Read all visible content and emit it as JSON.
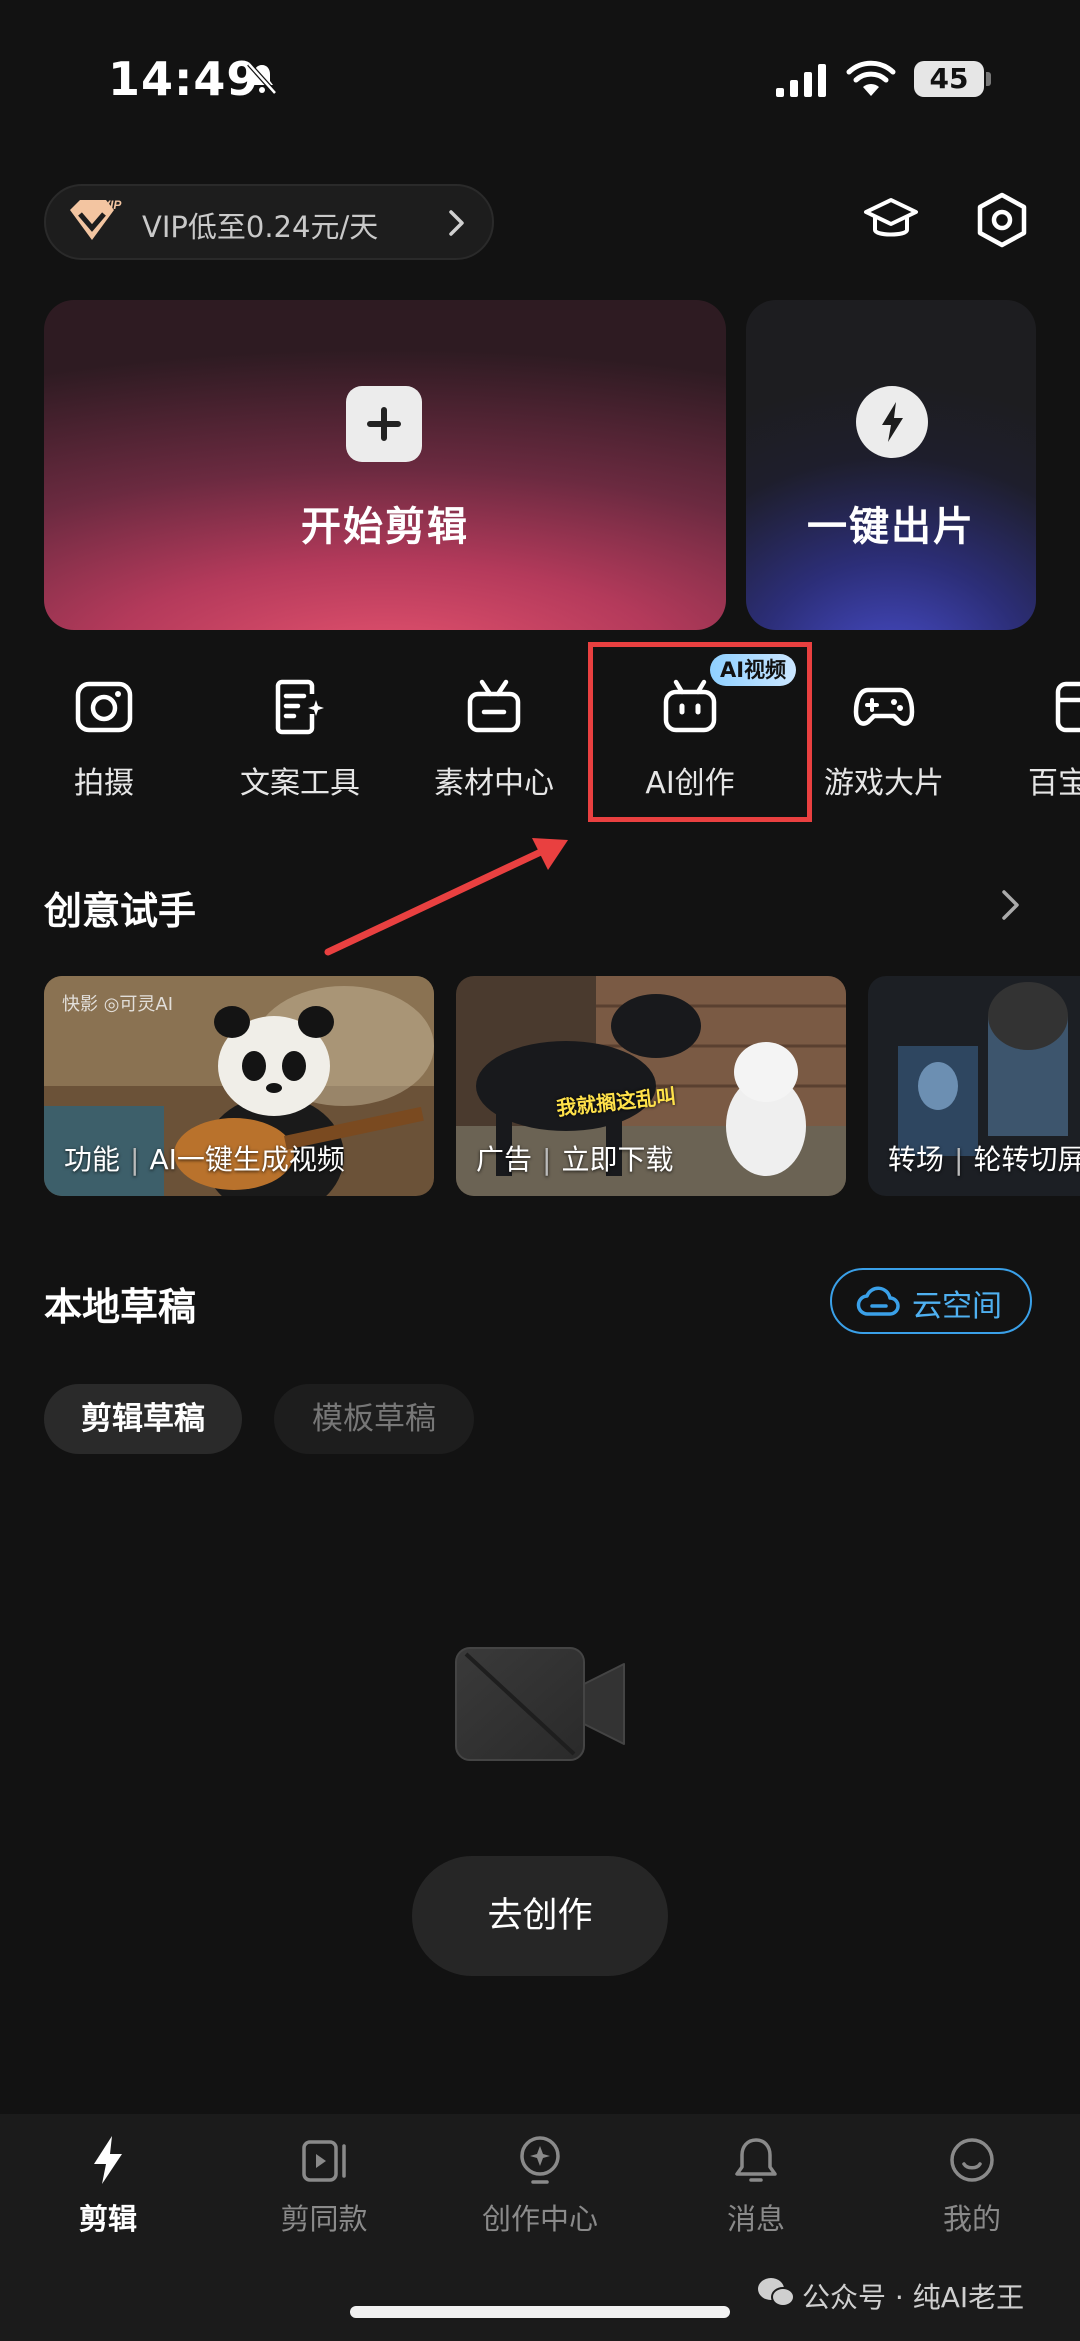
{
  "status": {
    "time": "14:49",
    "battery": "45"
  },
  "vip": {
    "text": "VIP低至0.24元/天",
    "badge": "VIP"
  },
  "hero": {
    "edit_label": "开始剪辑",
    "quick_label": "一键出片"
  },
  "tools": [
    {
      "label": "拍摄",
      "icon": "camera-icon"
    },
    {
      "label": "文案工具",
      "icon": "script-icon"
    },
    {
      "label": "素材中心",
      "icon": "material-icon"
    },
    {
      "label": "AI创作",
      "icon": "robot-icon",
      "badge": "AI视频"
    },
    {
      "label": "游戏大片",
      "icon": "gamepad-icon"
    },
    {
      "label": "百宝箱",
      "icon": "toolbox-icon"
    }
  ],
  "creative": {
    "title": "创意试手",
    "items": [
      {
        "tag": "功能",
        "title": "AI一键生成视频",
        "logo": "快影  ◎可灵AI"
      },
      {
        "tag": "广告",
        "title": "立即下载",
        "sticker": "我就搁这乱叫"
      },
      {
        "tag": "转场",
        "title": "轮转切屏"
      }
    ]
  },
  "drafts": {
    "title": "本地草稿",
    "cloud_label": "云空间",
    "tabs": [
      "剪辑草稿",
      "模板草稿"
    ],
    "cta": "去创作"
  },
  "nav": [
    {
      "label": "剪辑",
      "icon": "bolt-icon",
      "active": true
    },
    {
      "label": "剪同款",
      "icon": "template-icon"
    },
    {
      "label": "创作中心",
      "icon": "bulb-icon"
    },
    {
      "label": "消息",
      "icon": "bell-icon"
    },
    {
      "label": "我的",
      "icon": "smile-icon"
    }
  ],
  "watermark": "公众号 · 纯AI老王",
  "colors": {
    "accent_blue": "#3aa0e8",
    "highlight_red": "#e94040",
    "background": "#121212"
  }
}
